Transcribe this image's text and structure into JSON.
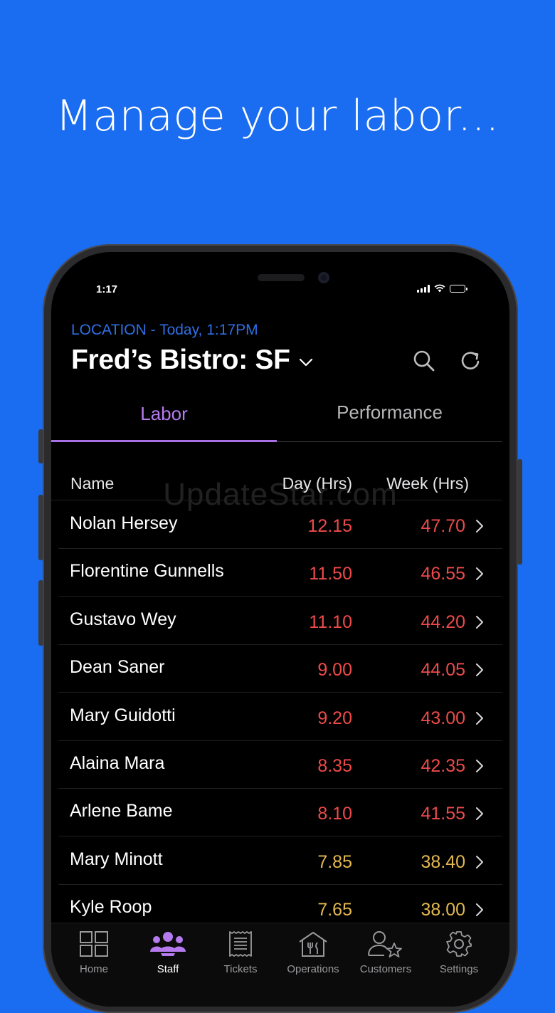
{
  "headline": "Manage your labor...",
  "status_bar": {
    "time": "1:17"
  },
  "header": {
    "location_line": "LOCATION - Today, 1:17PM",
    "title": "Fred’s Bistro: SF"
  },
  "tabs": [
    {
      "label": "Labor",
      "active": true
    },
    {
      "label": "Performance",
      "active": false
    }
  ],
  "table": {
    "columns": {
      "name": "Name",
      "day": "Day (Hrs)",
      "week": "Week (Hrs)"
    },
    "rows": [
      {
        "name": "Nolan Hersey",
        "day": "12.15",
        "week": "47.70",
        "status": "over"
      },
      {
        "name": "Florentine Gunnells",
        "day": "11.50",
        "week": "46.55",
        "status": "over"
      },
      {
        "name": "Gustavo Wey",
        "day": "11.10",
        "week": "44.20",
        "status": "over"
      },
      {
        "name": "Dean Saner",
        "day": "9.00",
        "week": "44.05",
        "status": "over"
      },
      {
        "name": "Mary Guidotti",
        "day": "9.20",
        "week": "43.00",
        "status": "over"
      },
      {
        "name": "Alaina Mara",
        "day": "8.35",
        "week": "42.35",
        "status": "over"
      },
      {
        "name": "Arlene Bame",
        "day": "8.10",
        "week": "41.55",
        "status": "over"
      },
      {
        "name": "Mary Minott",
        "day": "7.85",
        "week": "38.40",
        "status": "near"
      },
      {
        "name": "Kyle Roop",
        "day": "7.65",
        "week": "38.00",
        "status": "near"
      }
    ]
  },
  "watermark": "UpdateStar.com",
  "tab_bar": [
    {
      "label": "Home",
      "icon": "grid-icon",
      "active": false
    },
    {
      "label": "Staff",
      "icon": "people-icon",
      "active": true
    },
    {
      "label": "Tickets",
      "icon": "receipt-icon",
      "active": false
    },
    {
      "label": "Operations",
      "icon": "store-icon",
      "active": false
    },
    {
      "label": "Customers",
      "icon": "customer-star-icon",
      "active": false
    },
    {
      "label": "Settings",
      "icon": "gear-icon",
      "active": false
    }
  ],
  "colors": {
    "background": "#1a6cf0",
    "accent_purple": "#b57bee",
    "location_blue": "#2f6fe4",
    "over_red": "#ef4a4a",
    "near_yellow": "#e3b84f"
  }
}
